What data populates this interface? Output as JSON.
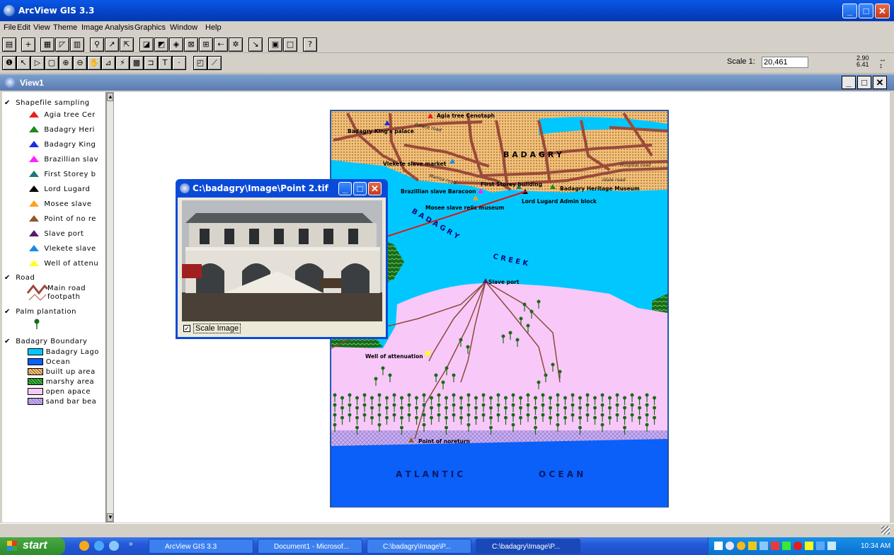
{
  "app": {
    "title": "ArcView GIS 3.3"
  },
  "menu": [
    "File",
    "Edit",
    "View",
    "Theme",
    "Image Analysis",
    "Graphics",
    "Window",
    "Help"
  ],
  "toolbar": {
    "scale_label": "Scale 1:",
    "scale_value": "20,461",
    "coord_x": "2.90",
    "coord_y": "6.41"
  },
  "view": {
    "title": "View1"
  },
  "legend": {
    "theme_sampling": "Shapefile sampling",
    "sampling_items": [
      {
        "label": "Agia tree Cer",
        "color": "#e82020"
      },
      {
        "label": "Badagry Heri",
        "color": "#1a8a1a"
      },
      {
        "label": "Badagry King",
        "color": "#1a2ae8"
      },
      {
        "label": "Brazillian slav",
        "color": "#ff20ff"
      },
      {
        "label": "First Storey b",
        "color": "#1a7a7a"
      },
      {
        "label": "Lord  Lugard",
        "color": "#000000"
      },
      {
        "label": "Mosee slave",
        "color": "#ffa020"
      },
      {
        "label": "Point of no re",
        "color": "#8a5a2a"
      },
      {
        "label": "Slave port",
        "color": "#5a1a6a"
      },
      {
        "label": "Vlekete slave",
        "color": "#1a8ae8"
      },
      {
        "label": "Well of attenu",
        "color": "#ffff20"
      }
    ],
    "theme_road": "Road",
    "road_items": [
      "Main road",
      "footpath"
    ],
    "theme_palm": "Palm plantation",
    "theme_boundary": "Badagry Boundary",
    "boundary_items": [
      {
        "label": "Badagry Lago",
        "color": "#00c8ff"
      },
      {
        "label": "Ocean",
        "color": "#0a60f8"
      },
      {
        "label": "built up area",
        "color": "#f4c078"
      },
      {
        "label": "marshy area",
        "color": "#1a7a1a"
      },
      {
        "label": "open apace",
        "color": "#f8c8f8"
      },
      {
        "label": "sand bar bea",
        "color": "#c8b0f0"
      }
    ]
  },
  "map": {
    "labels": {
      "town": "B A D A G R Y",
      "creek1": "B A D A G R Y",
      "creek2": "C R E E K",
      "ocean1": "A T L A N T I C",
      "ocean2": "O C E A N"
    },
    "sites": [
      "Agia tree Cenotaph",
      "Badagry King's palace",
      "Vlekete slave market",
      "Brazillian slave Baracoon",
      "First Storey building",
      "Badagry Heritage Museum",
      "Lord  Lugard Admin block",
      "Mosee slave relic museum",
      "Slave port",
      "Well of attenuation",
      "Point of noreturn"
    ],
    "roads": [
      "Palace road",
      "Marina road",
      "Hospital road",
      "Idale road"
    ]
  },
  "popup": {
    "title": "C:\\badagry\\Image\\Point 2.tif",
    "checkbox_label": "Scale Image",
    "checked": true
  },
  "taskbar": {
    "start": "start",
    "tasks": [
      "ArcView GIS 3.3",
      "Document1 - Microsof...",
      "C:\\badagry\\Image\\P...",
      "C:\\badagry\\Image\\P..."
    ],
    "clock": "10:34 AM"
  }
}
